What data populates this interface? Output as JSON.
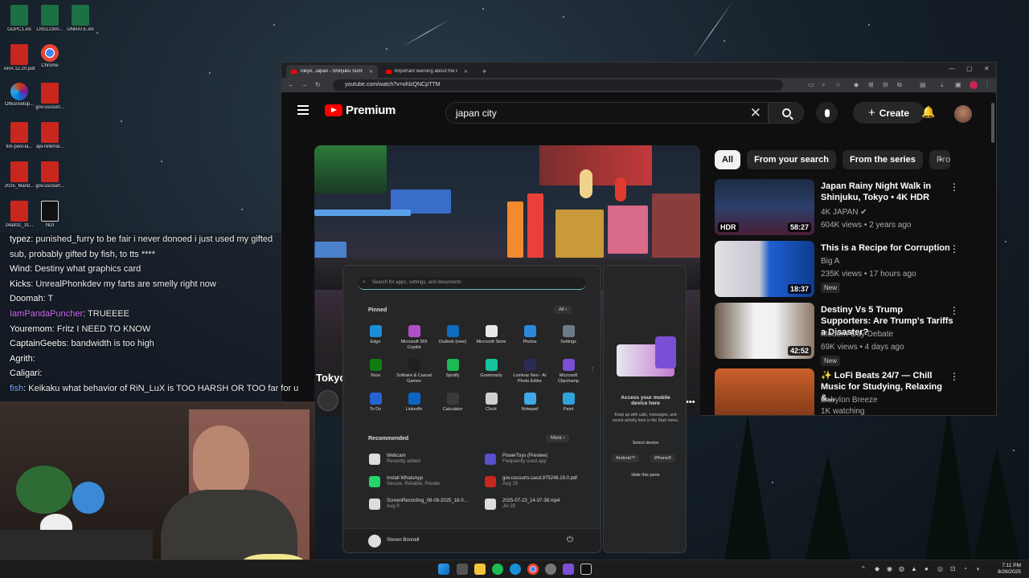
{
  "desktop_icons": [
    {
      "label": "GDPC1.xls",
      "kind": "xls"
    },
    {
      "label": "LNS12300...",
      "kind": "xls"
    },
    {
      "label": "UNRATE.xls",
      "kind": "xls"
    },
    {
      "label": "ARA 12.20.pdf",
      "kind": "pdf"
    },
    {
      "label": "Chrome",
      "kind": "chrome"
    },
    {
      "label": "OfficeSetup...",
      "kind": "office"
    },
    {
      "label": "gov.uscourt...",
      "kind": "pdf"
    },
    {
      "label": "tim-pool-la...",
      "kind": "pdf"
    },
    {
      "label": "api-referral...",
      "kind": "pdf"
    },
    {
      "label": "2025_Mand...",
      "kind": "pdf"
    },
    {
      "label": "gov.uscourt...",
      "kind": "pdf"
    },
    {
      "label": "24a831_31...",
      "kind": "pdf"
    },
    {
      "label": "NDI",
      "kind": "ndi"
    }
  ],
  "browser": {
    "tabs": [
      {
        "label": "Tokyo, Japan - Shinjuku Summer",
        "active": true
      },
      {
        "label": "Important warning about the lo",
        "active": false
      }
    ],
    "url": "youtube.com/watch?v=ohlzQNCpTTM",
    "youtube": {
      "logo_text": "Premium",
      "search_value": "japan city",
      "create_label": "Create",
      "video_title_fragment": "Tokyo",
      "chips": [
        "All",
        "From your search",
        "From the series",
        "Fro"
      ],
      "recommendations": [
        {
          "title": "Japan Rainy Night Walk in Shinjuku, Tokyo • 4K HDR",
          "channel": "4K JAPAN",
          "verified": true,
          "meta": "604K views • 2 years ago",
          "duration": "58:27",
          "tag": "HDR",
          "badge": ""
        },
        {
          "title": "This is a Recipe for Corruption",
          "channel": "Big A",
          "verified": false,
          "meta": "235K views • 17 hours ago",
          "duration": "18:37",
          "tag": "",
          "badge": "New"
        },
        {
          "title": "Destiny Vs 5 Trump Supporters: Are Trump's Tariffs a Disaster?",
          "channel": "Modern-Day Debate",
          "verified": true,
          "meta": "69K views • 4 days ago",
          "duration": "42:52",
          "tag": "",
          "badge": "New"
        },
        {
          "title": "✨ LoFi Beats 24/7 — Chill Music for Studying, Relaxing &...",
          "channel": "Babylon Breeze",
          "verified": false,
          "meta": "1K watching",
          "duration": "",
          "tag": "",
          "badge": ""
        }
      ]
    }
  },
  "chat": [
    {
      "user": "typez",
      "color": "#ffffff",
      "text": "punished_furry to be fair i never donoed i just used my gifted"
    },
    {
      "user": "",
      "color": "#ffffff",
      "text": "sub, probably gifted by fish, to tts ****"
    },
    {
      "user": "Wind",
      "color": "#ffffff",
      "text": "Destiny what graphics card"
    },
    {
      "user": "Kicks",
      "color": "#ffffff",
      "text": "UnrealPhonkdev my farts are smelly right now"
    },
    {
      "user": "Doomah",
      "color": "#ffffff",
      "text": "T"
    },
    {
      "user": "IamPandaPuncher",
      "color": "#d36cff",
      "text": "TRUEEEE"
    },
    {
      "user": "Youremom",
      "color": "#ffffff",
      "text": "Fritz I NEED TO KNOW"
    },
    {
      "user": "CaptainGeebs",
      "color": "#ffffff",
      "text": "bandwidth is too high"
    },
    {
      "user": "Agrith",
      "color": "#ffffff",
      "text": ""
    },
    {
      "user": "Caligari",
      "color": "#ffffff",
      "text": ""
    },
    {
      "user": "fish",
      "color": "#7aa7ff",
      "text": "Keikaku what behavior of RiN_LuX is TOO HARSH OR TOO far for u"
    }
  ],
  "start_menu": {
    "search_placeholder": "Search for apps, settings, and documents",
    "pinned_label": "Pinned",
    "all_label": "All",
    "pinned": [
      {
        "label": "Edge",
        "color": "#1a8fd8"
      },
      {
        "label": "Microsoft 365 Copilot",
        "color": "#b04fc9"
      },
      {
        "label": "Outlook (new)",
        "color": "#0f6cbd"
      },
      {
        "label": "Microsoft Store",
        "color": "#e9e9e9"
      },
      {
        "label": "Photos",
        "color": "#2b88d8"
      },
      {
        "label": "Settings",
        "color": "#6c7a89"
      },
      {
        "label": "Xbox",
        "color": "#107c10"
      },
      {
        "label": "Solitaire & Casual Games",
        "color": "#1f1f1f"
      },
      {
        "label": "Spotify",
        "color": "#1db954"
      },
      {
        "label": "Grammarly",
        "color": "#15c39a"
      },
      {
        "label": "Luminar Neo - AI Photo Editor",
        "color": "#2a2a55"
      },
      {
        "label": "Microsoft Clipchamp",
        "color": "#7b4fd6"
      },
      {
        "label": "To Do",
        "color": "#2564cf"
      },
      {
        "label": "LinkedIn",
        "color": "#0a66c2"
      },
      {
        "label": "Calculator",
        "color": "#3a3a3a"
      },
      {
        "label": "Clock",
        "color": "#cfcfcf"
      },
      {
        "label": "Notepad",
        "color": "#3fa9e8"
      },
      {
        "label": "Paint",
        "color": "#2fa3d9"
      }
    ],
    "recommended_label": "Recommended",
    "more_label": "More",
    "recommended": [
      {
        "title": "Webcam",
        "sub": "Recently added",
        "color": "#dddddd"
      },
      {
        "title": "PowerToys (Preview)",
        "sub": "Frequently used app",
        "color": "#5a4fcf"
      },
      {
        "title": "Install WhatsApp",
        "sub": "Secure, Reliable, Private.",
        "color": "#25d366"
      },
      {
        "title": "gov.uscourts.cacd.975246.19.0.pdf",
        "sub": "Aug 19",
        "color": "#c9261e"
      },
      {
        "title": "ScreenRecording_08-08-2025_18-0...",
        "sub": "Aug 9",
        "color": "#dddddd"
      },
      {
        "title": "2025-07-23_14-37-38.mp4",
        "sub": "Jul 29",
        "color": "#dddddd"
      }
    ],
    "user_name": "Steven Bonnell"
  },
  "mobile_panel": {
    "title": "Access your mobile device here",
    "desc": "Keep up with calls, messages, and recent activity here in the Start menu.",
    "select_label": "Select device",
    "android": "Android™",
    "iphone": "iPhone®",
    "hide": "Hide this pane"
  },
  "taskbar": {
    "time": "7:11 PM",
    "date": "8/26/2025"
  }
}
